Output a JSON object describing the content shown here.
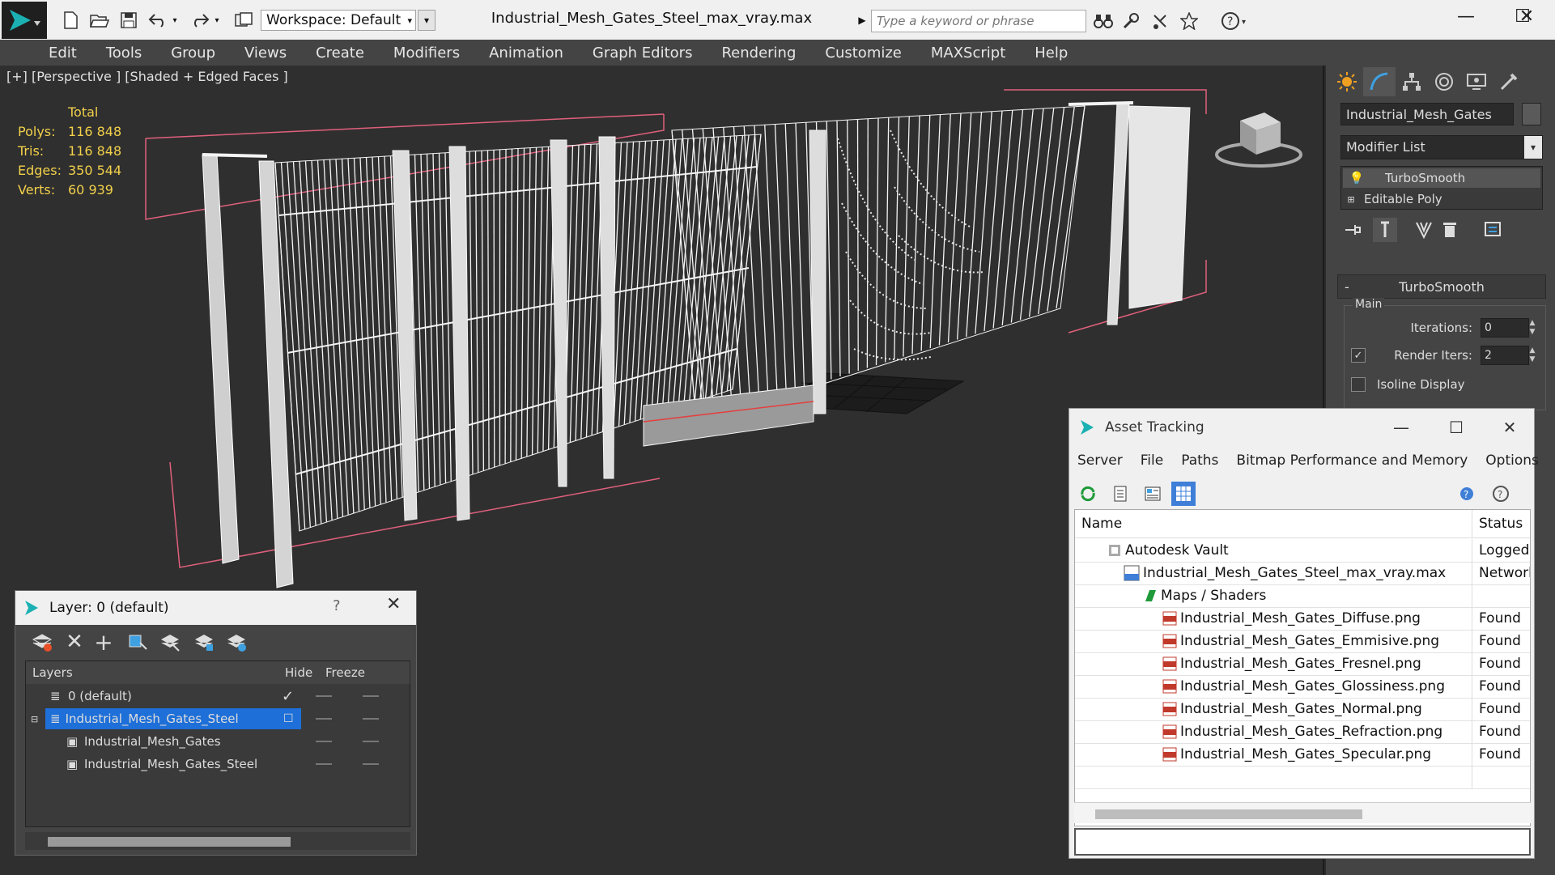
{
  "app": {
    "title": "Industrial_Mesh_Gates_Steel_max_vray.max",
    "workspace": "Workspace: Default",
    "search_placeholder": "Type a keyword or phrase",
    "menu": [
      "Edit",
      "Tools",
      "Group",
      "Views",
      "Create",
      "Modifiers",
      "Animation",
      "Graph Editors",
      "Rendering",
      "Customize",
      "MAXScript",
      "Help"
    ]
  },
  "viewport": {
    "label": "[+] [Perspective ] [Shaded + Edged Faces ]",
    "stats_header": "Total",
    "stats": [
      {
        "key": "Polys:",
        "value": "116 848"
      },
      {
        "key": "Tris:",
        "value": "116 848"
      },
      {
        "key": "Edges:",
        "value": "350 544"
      },
      {
        "key": "Verts:",
        "value": "60 939"
      }
    ],
    "stats_color": "#f2d04a"
  },
  "command_panel": {
    "object_name": "Industrial_Mesh_Gates",
    "modifier_list": "Modifier List",
    "stack": [
      "TurboSmooth",
      "Editable Poly"
    ],
    "rollout_title": "TurboSmooth",
    "group_label": "Main",
    "iterations_label": "Iterations:",
    "iterations_value": "0",
    "render_iters_label": "Render Iters:",
    "render_iters_value": "2",
    "isoline_label": "Isoline Display"
  },
  "layer_window": {
    "title": "Layer: 0 (default)",
    "help": "?",
    "columns": {
      "layers": "Layers",
      "hide": "Hide",
      "freeze": "Freeze"
    },
    "rows": [
      {
        "name": "0 (default)"
      },
      {
        "name": "Industrial_Mesh_Gates_Steel"
      },
      {
        "name": "Industrial_Mesh_Gates"
      },
      {
        "name": "Industrial_Mesh_Gates_Steel"
      }
    ],
    "selected_color": "#1e6fd8"
  },
  "asset_window": {
    "title": "Asset Tracking",
    "menu": [
      "Server",
      "File",
      "Paths",
      "Bitmap Performance and Memory",
      "Options"
    ],
    "columns": {
      "name": "Name",
      "status": "Status"
    },
    "rows": [
      {
        "name": "Autodesk Vault",
        "status": "Logged O"
      },
      {
        "name": "Industrial_Mesh_Gates_Steel_max_vray.max",
        "status": "Network"
      },
      {
        "name": "Maps / Shaders",
        "status": ""
      },
      {
        "name": "Industrial_Mesh_Gates_Diffuse.png",
        "status": "Found"
      },
      {
        "name": "Industrial_Mesh_Gates_Emmisive.png",
        "status": "Found"
      },
      {
        "name": "Industrial_Mesh_Gates_Fresnel.png",
        "status": "Found"
      },
      {
        "name": "Industrial_Mesh_Gates_Glossiness.png",
        "status": "Found"
      },
      {
        "name": "Industrial_Mesh_Gates_Normal.png",
        "status": "Found"
      },
      {
        "name": "Industrial_Mesh_Gates_Refraction.png",
        "status": "Found"
      },
      {
        "name": "Industrial_Mesh_Gates_Specular.png",
        "status": "Found"
      }
    ]
  }
}
